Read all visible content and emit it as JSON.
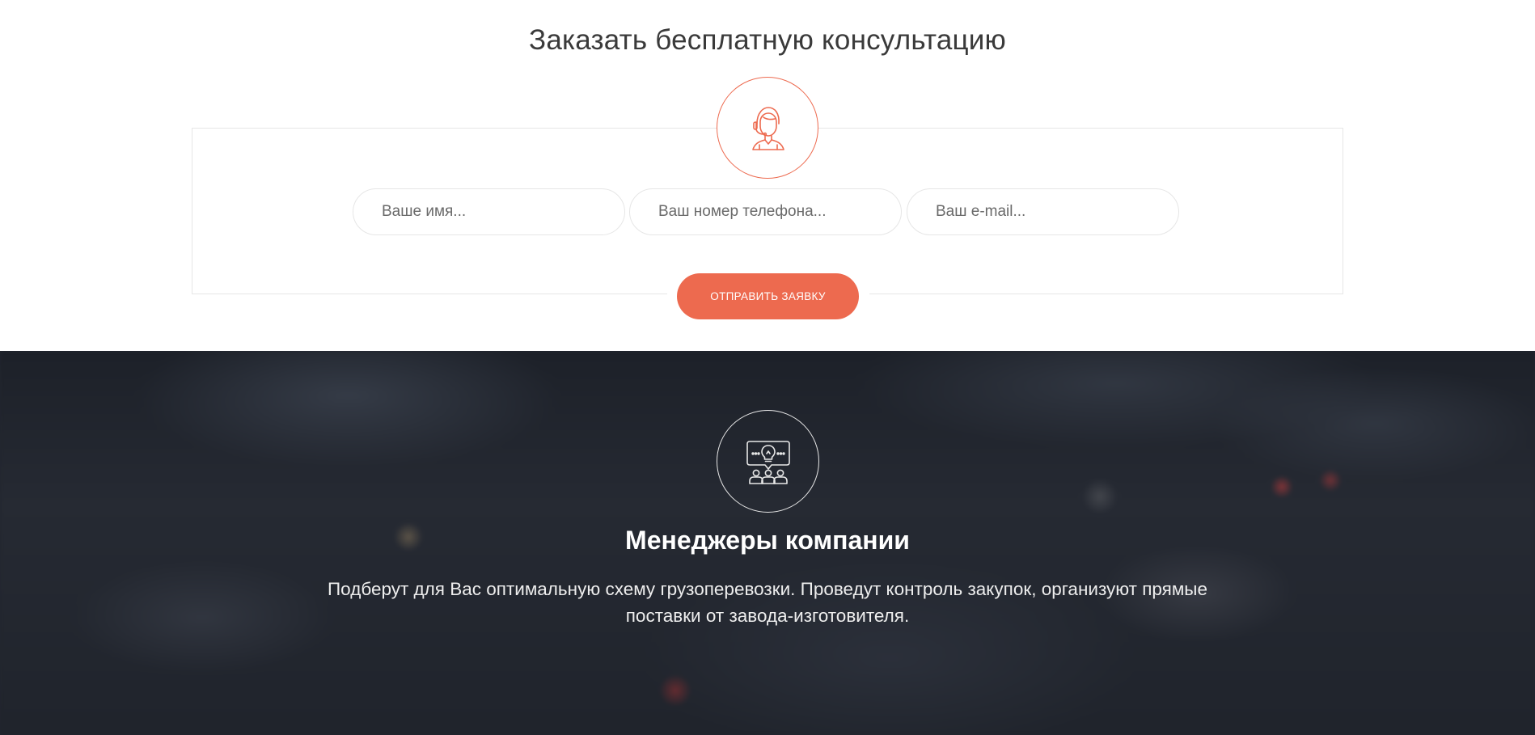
{
  "consultation": {
    "title": "Заказать бесплатную консультацию",
    "avatar_icon": "operator-headset-icon",
    "form": {
      "name_placeholder": "Ваше имя...",
      "phone_placeholder": "Ваш номер телефона...",
      "email_placeholder": "Ваш e-mail...",
      "submit_label": "ОТПРАВИТЬ ЗАЯВКУ"
    }
  },
  "managers": {
    "icon": "team-idea-icon",
    "title": "Менеджеры компании",
    "text": "Подберут для Вас оптимальную схему грузоперевозки. Проведут контроль закупок, организуют прямые поставки от завода-изготовителя."
  },
  "colors": {
    "accent": "#ed6a4f",
    "dark_bg": "#22262f",
    "border": "#e6e6e6"
  }
}
